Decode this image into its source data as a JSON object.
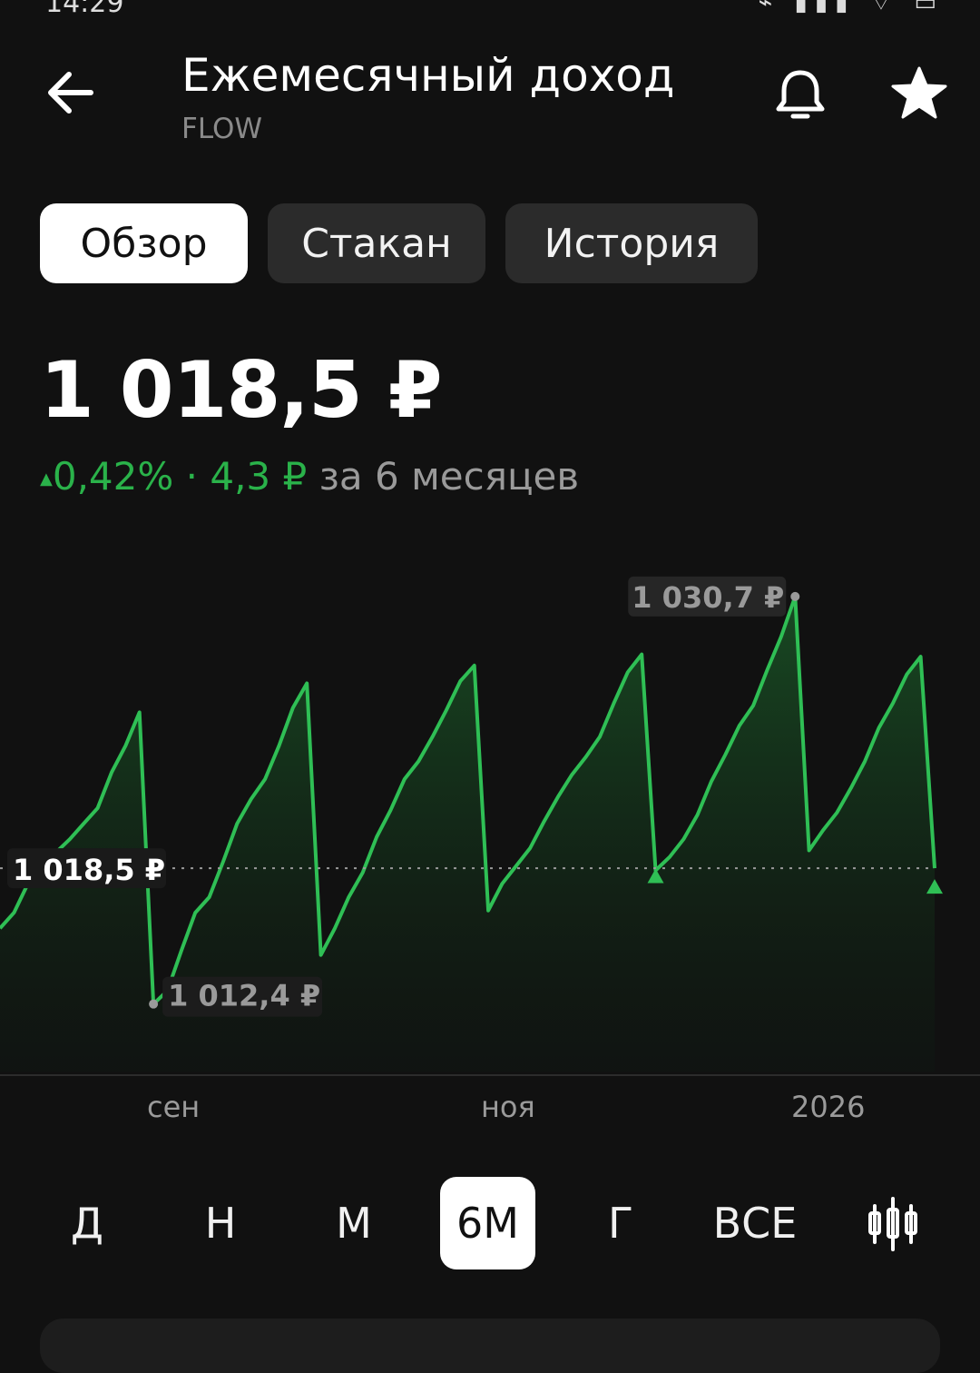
{
  "status_bar": {
    "time": "14:29",
    "icons": "⌁ ▮▮▮ ⌔ ▭"
  },
  "header": {
    "title": "Ежемесячный доход",
    "subtitle": "FLOW"
  },
  "tabs": [
    {
      "label": "Обзор",
      "active": true
    },
    {
      "label": "Стакан",
      "active": false
    },
    {
      "label": "История",
      "active": false
    }
  ],
  "price": {
    "current": "1 018,5 ₽",
    "change_percent": "0,42%",
    "change_abs": "4,3 ₽",
    "period": "за 6 месяцев"
  },
  "chart_data": {
    "type": "area",
    "y_unit": "₽",
    "ylim": [
      1011.0,
      1032.0
    ],
    "current_value": 1018.5,
    "current_label": "1 018,5 ₽",
    "max_label": "1 030,7 ₽",
    "max_value": 1030.7,
    "min_label": "1 012,4 ₽",
    "min_value": 1012.4,
    "x_tick_labels": [
      "сен",
      "ноя",
      "2026"
    ],
    "series_color": "#2fbf55",
    "values": [
      1015.8,
      1016.5,
      1017.8,
      1018.2,
      1019.2,
      1019.8,
      1020.5,
      1021.2,
      1022.8,
      1024.0,
      1025.5,
      1012.4,
      1013.0,
      1014.8,
      1016.5,
      1017.2,
      1018.8,
      1020.5,
      1021.6,
      1022.5,
      1024.0,
      1025.7,
      1026.8,
      1014.6,
      1015.8,
      1017.2,
      1018.3,
      1019.9,
      1021.1,
      1022.5,
      1023.3,
      1024.4,
      1025.6,
      1026.9,
      1027.6,
      1016.6,
      1017.8,
      1018.6,
      1019.4,
      1020.6,
      1021.7,
      1022.7,
      1023.5,
      1024.4,
      1025.9,
      1027.3,
      1028.1,
      1018.4,
      1019.0,
      1019.8,
      1020.9,
      1022.4,
      1023.6,
      1024.9,
      1025.8,
      1027.4,
      1028.9,
      1030.7,
      1019.3,
      1020.2,
      1021.0,
      1022.1,
      1023.3,
      1024.8,
      1025.9,
      1027.2,
      1028.0,
      1018.5
    ],
    "markers": [
      {
        "index": 47,
        "type": "dividend"
      },
      {
        "index": 67,
        "type": "dividend"
      }
    ]
  },
  "ranges": [
    {
      "label": "Д",
      "selected": false
    },
    {
      "label": "Н",
      "selected": false
    },
    {
      "label": "М",
      "selected": false
    },
    {
      "label": "6М",
      "selected": true
    },
    {
      "label": "Г",
      "selected": false
    },
    {
      "label": "ВСЕ",
      "selected": false
    }
  ],
  "icons": {
    "back": "arrow-left-icon",
    "bell": "bell-icon",
    "star": "star-icon",
    "candles": "candlestick-icon"
  }
}
